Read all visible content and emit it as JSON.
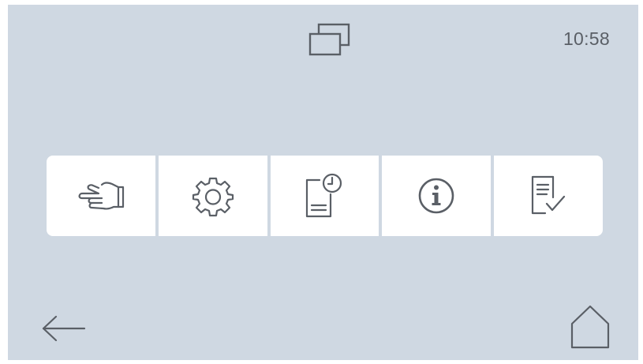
{
  "status_bar": {
    "time": "10:58",
    "windows_icon": "overlapping-windows-icon"
  },
  "menu": {
    "items": [
      {
        "id": "manual",
        "icon": "hand-icon"
      },
      {
        "id": "settings",
        "icon": "gear-icon"
      },
      {
        "id": "log",
        "icon": "document-clock-icon"
      },
      {
        "id": "info",
        "icon": "info-icon"
      },
      {
        "id": "checklist",
        "icon": "document-check-icon"
      }
    ]
  },
  "navigation": {
    "back_icon": "back-arrow-icon",
    "home_icon": "home-icon"
  },
  "colors": {
    "background": "#cfd8e2",
    "tile": "#ffffff",
    "icon_stroke": "#5a5f66"
  }
}
